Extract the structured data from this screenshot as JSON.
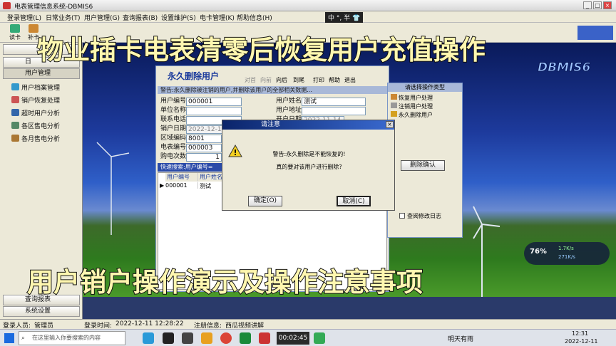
{
  "window": {
    "title": "电表管理信息系统-DBMIS6"
  },
  "menu": [
    "登录管理(L)",
    "日常业务(T)",
    "用户管理(G)",
    "查询报表(B)",
    "设置维护(S)",
    "电卡管理(K)",
    "帮助信息(H)"
  ],
  "toolbar": [
    "读卡",
    "补卡"
  ],
  "leftpanel": {
    "top_btn": "日",
    "user_btn": "用户管理",
    "items": [
      "用户档案管理",
      "销户恢复处理",
      "超时用户分析",
      "各区售电分析",
      "各月售电分析"
    ],
    "query_btn": "查询报表",
    "settings_btn": "系统设置"
  },
  "overlay": {
    "top": "物业插卡电表清零后恢复用户充值操作",
    "bottom": "用户销户操作演示及操作注意事项",
    "brand": "DBMIS6"
  },
  "ime": "中 °, 半 👕",
  "dialog": {
    "title": "永久删除用户",
    "tools": [
      "对首",
      "向前",
      "向后",
      "到尾",
      "打印",
      "帮助",
      "退出"
    ],
    "warning": "警告:永久删除被注销的用户,并删除该用户的全部相关数据...",
    "fields": [
      {
        "label": "用户编号",
        "value": "000001"
      },
      {
        "label": "单位名称",
        "value": ""
      },
      {
        "label": "联系电话",
        "value": ""
      },
      {
        "label": "销户日期",
        "value": "2022-12-11"
      },
      {
        "label": "区域编码",
        "value": "8001"
      },
      {
        "label": "电表编号",
        "value": "000003"
      },
      {
        "label": "购电次数",
        "value": "1"
      }
    ],
    "right_fields": [
      {
        "label": "用户姓名",
        "value": "测试"
      },
      {
        "label": "用户地址",
        "value": ""
      },
      {
        "label": "开户日期",
        "value": "2022-11-14"
      }
    ],
    "search_label": "快速搜索:用户编号=",
    "table": {
      "headers": [
        "用户编号",
        "用户姓名"
      ],
      "rows": [
        [
          "000001",
          "测试"
        ]
      ]
    },
    "op_title": "请选择操作类型",
    "ops": [
      "恢复用户处理",
      "注销用户处理",
      "永久删除用户"
    ],
    "delete_btn": "删除确认",
    "log_check": "查阅修改日志"
  },
  "confirm": {
    "title": "请注意",
    "line1": "警告:永久删除是不能恢复的!",
    "line2": "真的要对该用户进行删除?",
    "ok": "确定(O)",
    "cancel": "取消(C)"
  },
  "status": {
    "user_label": "登录人员:",
    "user": "管理员",
    "time_label": "登录时间:",
    "time": "2022-12-11 12:28:22",
    "reg_label": "注册信息:",
    "reg": "西瓜视频讲解"
  },
  "taskbar": {
    "search": "在这里输入你要搜索的内容",
    "timer": "00:02:45",
    "weather": "明天有雨",
    "time": "12:31",
    "date": "2022-12-11"
  },
  "widget": {
    "percent": "76%",
    "up": "1.7K/s",
    "down": "271K/s"
  },
  "colors": {
    "accent": "#1a3a9c",
    "overlay_text": "#fff7b0"
  }
}
